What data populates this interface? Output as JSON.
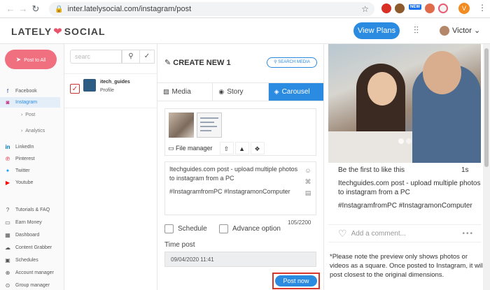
{
  "browser": {
    "url": "inter.latelysocial.com/instagram/post",
    "new_badge": "NEW",
    "profile_initial": "V"
  },
  "header": {
    "logo_left": "LATELY",
    "logo_right": "SOCIAL",
    "view_plans": "View Plans",
    "user_name": "Victor ⌄"
  },
  "sidebar": {
    "post_all": "Post to All",
    "networks": [
      {
        "label": "Facebook",
        "icon": "facebook-icon"
      },
      {
        "label": "Instagram",
        "icon": "instagram-icon"
      },
      {
        "label": "LinkedIn",
        "icon": "linkedin-icon"
      },
      {
        "label": "Pinterest",
        "icon": "pinterest-icon"
      },
      {
        "label": "Twitter",
        "icon": "twitter-icon"
      },
      {
        "label": "Youtube",
        "icon": "youtube-icon"
      }
    ],
    "sub_items": [
      "Post",
      "Analytics"
    ],
    "tools": [
      {
        "label": "Tutorials & FAQ",
        "icon": "help-icon"
      },
      {
        "label": "Earn Money",
        "icon": "money-icon"
      },
      {
        "label": "Dashboard",
        "icon": "dashboard-icon"
      },
      {
        "label": "Content Grabber",
        "icon": "cloud-icon"
      },
      {
        "label": "Schedules",
        "icon": "calendar-icon"
      },
      {
        "label": "Account manager",
        "icon": "plus-circle-icon"
      },
      {
        "label": "Group manager",
        "icon": "group-icon"
      }
    ]
  },
  "accounts": {
    "search_placeholder": "searc",
    "list": [
      {
        "name": "itech_guides",
        "type": "Profile"
      }
    ]
  },
  "create": {
    "title": "CREATE NEW 1",
    "search_media": "SEARCH MEDIA",
    "tabs": [
      "Media",
      "Story",
      "Carousel"
    ],
    "file_manager": "File manager",
    "caption_line1": "Itechguides.com post - upload multiple photos to instagram from a PC",
    "caption_line2": "#InstagramfromPC #InstagramonComputer",
    "char_count": "105/2200",
    "schedule": "Schedule",
    "advance_option": "Advance option",
    "time_post_label": "Time post",
    "time_post_value": "09/04/2020 11:41",
    "post_now": "Post now"
  },
  "preview": {
    "likes": "Be the first to like this",
    "time": "1s",
    "caption_line1": "Itechguides.com post - upload multiple photos to instagram from a PC",
    "caption_line2": "#InstagramfromPC #InstagramonComputer",
    "comment_placeholder": "Add a comment...",
    "note": "*Please note the preview only shows photos or videos as a square. Once posted to Instagram, it will post closest to the original dimensions."
  },
  "colors": {
    "accent": "#2b8be0",
    "brand_pink": "#f0707f",
    "highlight_border": "#d9362b"
  }
}
